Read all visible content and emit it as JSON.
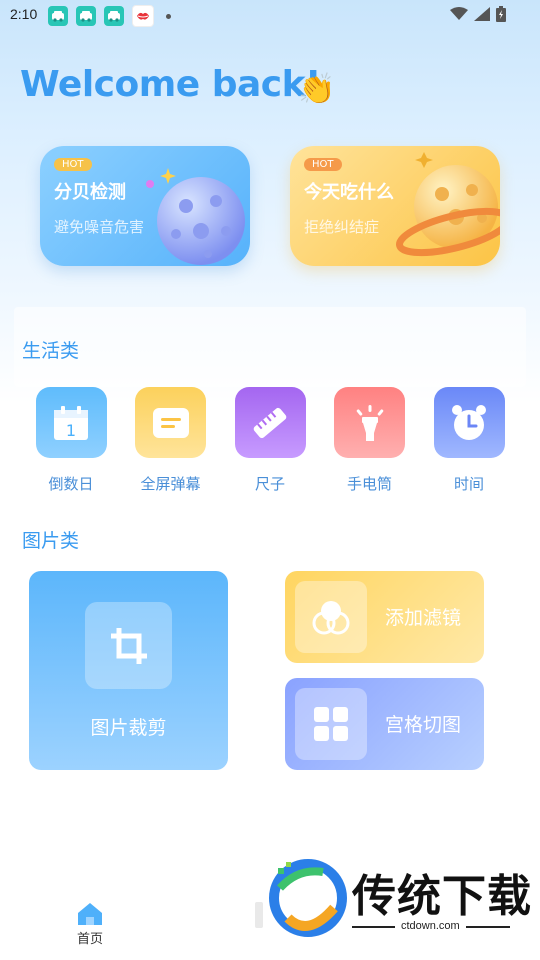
{
  "status_bar": {
    "time": "2:10",
    "notification_icons": [
      "app-icon-teal",
      "app-icon-teal",
      "app-icon-teal",
      "app-icon-red-lips"
    ],
    "system_icons": [
      "wifi-icon",
      "signal-icon",
      "battery-icon"
    ]
  },
  "header": {
    "welcome": "Welcome back!",
    "wave_emoji": "👏"
  },
  "hot_cards": [
    {
      "badge": "HOT",
      "title": "分贝检测",
      "subtitle": "避免噪音危害",
      "color": "#5ab4fb"
    },
    {
      "badge": "HOT",
      "title": "今天吃什么",
      "subtitle": "拒绝纠结症",
      "color": "#fcc445"
    }
  ],
  "life_section": {
    "title": "生活类",
    "tools": [
      {
        "label": "倒数日",
        "icon": "calendar-icon",
        "color": "#4bb1fb"
      },
      {
        "label": "全屏弹幕",
        "icon": "message-icon",
        "color": "#fcc445"
      },
      {
        "label": "尺子",
        "icon": "ruler-icon",
        "color": "#b06cf2"
      },
      {
        "label": "手电筒",
        "icon": "flashlight-icon",
        "color": "#ff8a8a"
      },
      {
        "label": "时间",
        "icon": "alarm-clock-icon",
        "color": "#6b86f6"
      }
    ]
  },
  "image_section": {
    "title": "图片类",
    "crop_label": "图片裁剪",
    "filter_label": "添加滤镜",
    "grid_label": "宫格切图"
  },
  "bottom_nav": {
    "home_label": "首页"
  },
  "watermark": {
    "brand": "传统下载",
    "url": "ctdown.com"
  }
}
